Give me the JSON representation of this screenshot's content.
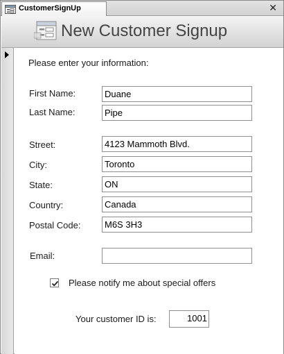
{
  "window": {
    "tab_title": "CustomerSignUp",
    "close_label": "✕",
    "tab_icon": "form-icon"
  },
  "header": {
    "title": "New Customer Signup",
    "icon": "form-icon"
  },
  "form": {
    "prompt": "Please enter your information:",
    "fields": {
      "first_name": {
        "label": "First Name:",
        "value": "Duane"
      },
      "last_name": {
        "label": "Last Name:",
        "value": "Pipe"
      },
      "street": {
        "label": "Street:",
        "value": "4123 Mammoth Blvd."
      },
      "city": {
        "label": "City:",
        "value": "Toronto"
      },
      "state": {
        "label": "State:",
        "value": "ON"
      },
      "country": {
        "label": "Country:",
        "value": "Canada"
      },
      "postal_code": {
        "label": "Postal Code:",
        "value": "M6S 3H3"
      },
      "email": {
        "label": "Email:",
        "value": ""
      }
    },
    "notify": {
      "label": "Please notify me about special offers",
      "checked": true
    },
    "customer_id": {
      "label": "Your customer ID is:",
      "value": "1001"
    }
  }
}
